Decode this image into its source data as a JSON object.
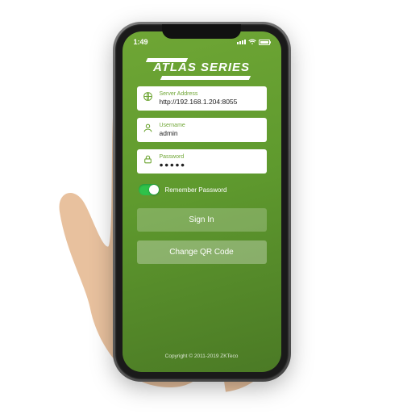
{
  "status": {
    "time": "1:49"
  },
  "brand": {
    "name": "ATLAS SERIES"
  },
  "fields": {
    "server": {
      "label": "Server Address",
      "value": "http://192.168.1.204:8055"
    },
    "username": {
      "label": "Username",
      "value": "admin"
    },
    "password": {
      "label": "Password",
      "value": "●●●●●"
    }
  },
  "toggle": {
    "label": "Remember Password",
    "on": true
  },
  "buttons": {
    "signin": "Sign In",
    "qr": "Change QR Code"
  },
  "footer": {
    "copyright": "Copyright © 2011-2019 ZKTeco"
  }
}
